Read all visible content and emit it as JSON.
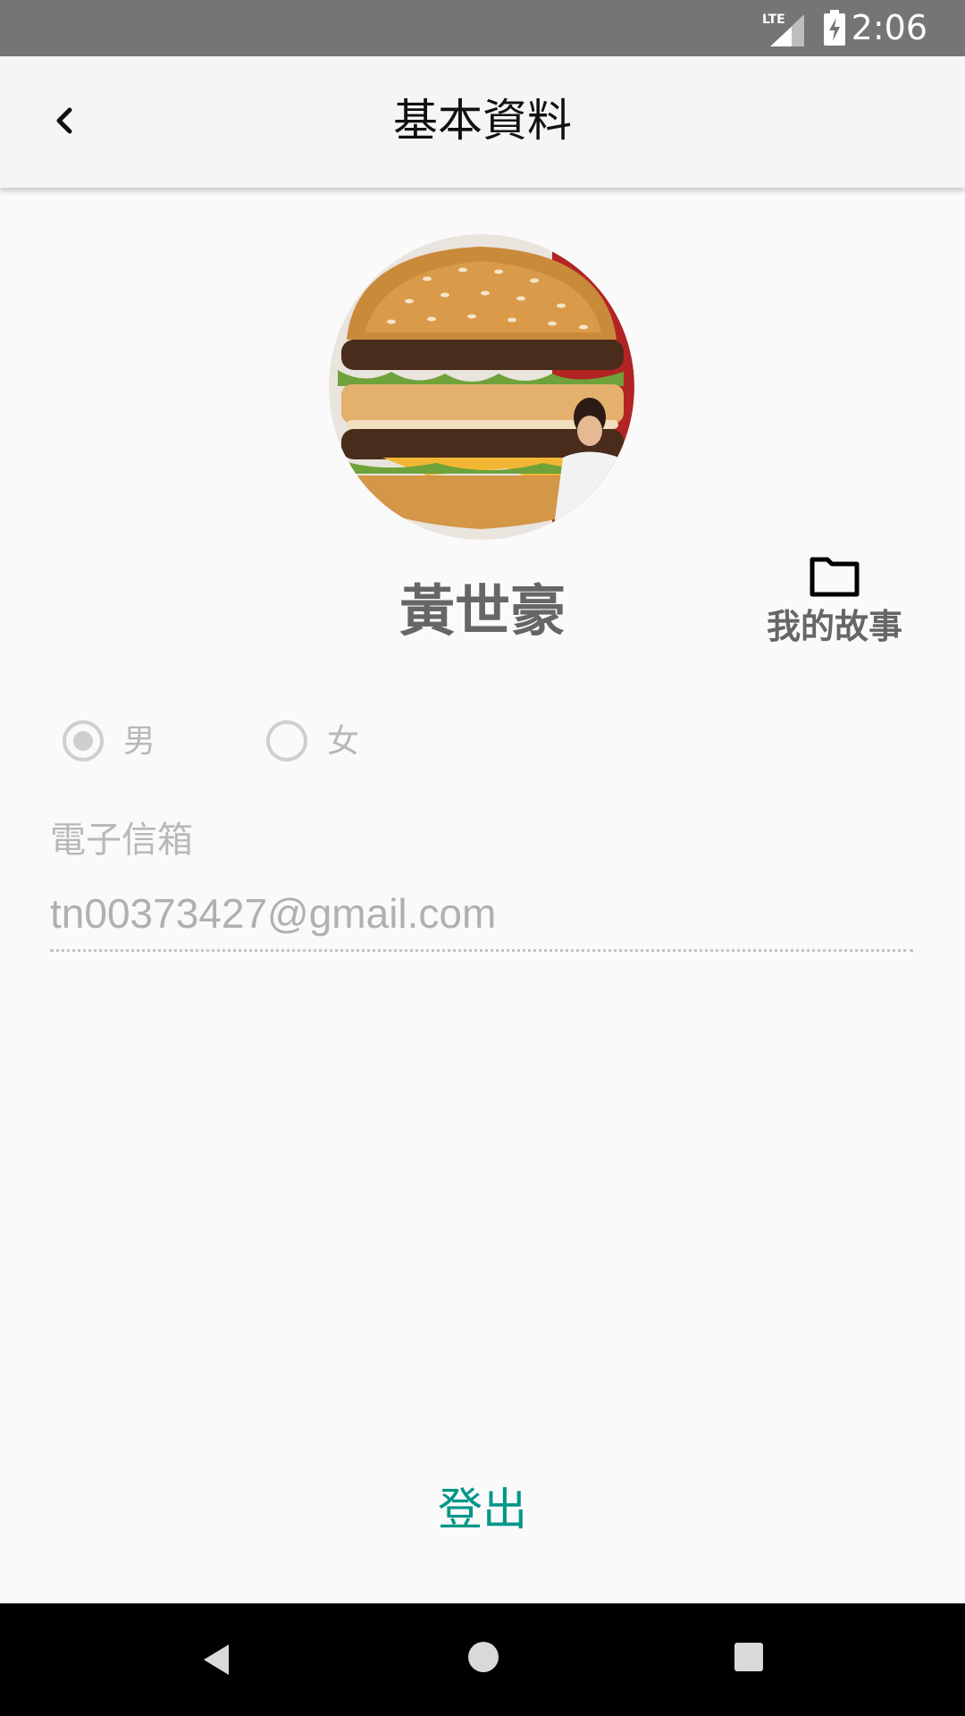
{
  "status_bar": {
    "network_label": "LTE",
    "time": "2:06",
    "icons": [
      "lte-signal-icon",
      "battery-charging-icon"
    ]
  },
  "app_bar": {
    "title": "基本資料",
    "back_icon": "chevron-left-icon"
  },
  "profile": {
    "avatar_image": "burger-photo",
    "name": "黃世豪"
  },
  "my_story": {
    "icon": "folder-icon",
    "label": "我的故事"
  },
  "gender": {
    "selected": "男",
    "options": [
      {
        "label": "男",
        "selected": true
      },
      {
        "label": "女",
        "selected": false
      }
    ]
  },
  "email": {
    "label": "電子信箱",
    "value": "tn00373427@gmail.com"
  },
  "logout_label": "登出",
  "nav_bar": {
    "icons": [
      "nav-back-icon",
      "nav-home-icon",
      "nav-recents-icon"
    ]
  },
  "colors": {
    "accent": "#009688",
    "status_bar": "#757575",
    "app_bar": "#f5f5f5",
    "background": "#fafafa"
  }
}
